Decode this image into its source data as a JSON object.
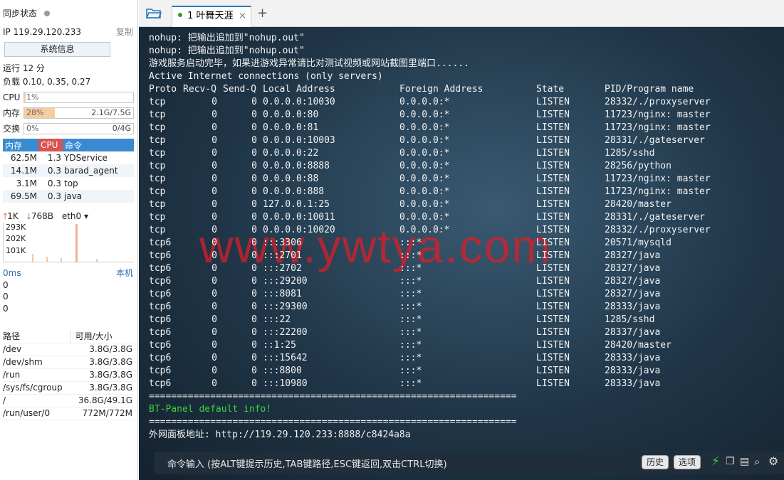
{
  "sidebar": {
    "sync_label": "同步状态",
    "ip": "IP 119.29.120.233",
    "copy": "复制",
    "sysinfo": "系统信息",
    "uptime": "运行 12 分",
    "load": "负载 0.10, 0.35, 0.27",
    "cpu_label": "CPU",
    "cpu_pct": "1%",
    "cpu_fill": 0.01,
    "mem_label": "内存",
    "mem_pct": "28%",
    "mem_size": "2.1G/7.5G",
    "mem_fill": 0.28,
    "swap_label": "交换",
    "swap_pct": "0%",
    "swap_size": "0/4G",
    "swap_fill": 0,
    "proc_headers": [
      "内存",
      "CPU",
      "命令"
    ],
    "procs": [
      [
        "62.5M",
        "1.3",
        "YDService"
      ],
      [
        "14.1M",
        "0.3",
        "barad_agent"
      ],
      [
        "3.1M",
        "0.3",
        "top"
      ],
      [
        "69.5M",
        "0.3",
        "java"
      ]
    ],
    "net_up": "1K",
    "net_down": "768B",
    "net_if": "eth0",
    "net_ticks": [
      "293K",
      "202K",
      "101K"
    ],
    "ping_label": "0ms",
    "ping_host": "本机",
    "ping_rows": [
      "0",
      "0",
      "0"
    ],
    "disk_headers": [
      "路径",
      "可用/大小"
    ],
    "disks": [
      [
        "/dev",
        "3.8G/3.8G"
      ],
      [
        "/dev/shm",
        "3.8G/3.8G"
      ],
      [
        "/run",
        "3.8G/3.8G"
      ],
      [
        "/sys/fs/cgroup",
        "3.8G/3.8G"
      ],
      [
        "/",
        "36.8G/49.1G"
      ],
      [
        "/run/user/0",
        "772M/772M"
      ]
    ]
  },
  "tabs": [
    {
      "label": "1 叶舞天涯",
      "active": true
    }
  ],
  "terminal": {
    "intro": [
      "nohup: 把输出追加到\"nohup.out\"",
      "nohup: 把输出追加到\"nohup.out\"",
      "游戏服务启动完毕，如果进游戏异常请比对测试视频或网站截图里端口......",
      "Active Internet connections (only servers)"
    ],
    "headers": [
      "Proto",
      "Recv-Q",
      "Send-Q",
      "Local Address",
      "Foreign Address",
      "State",
      "PID/Program name"
    ],
    "rows": [
      [
        "tcp",
        "0",
        "0",
        "0.0.0.0:10030",
        "0.0.0.0:*",
        "LISTEN",
        "28332/./proxyserver"
      ],
      [
        "tcp",
        "0",
        "0",
        "0.0.0.0:80",
        "0.0.0.0:*",
        "LISTEN",
        "11723/nginx: master"
      ],
      [
        "tcp",
        "0",
        "0",
        "0.0.0.0:81",
        "0.0.0.0:*",
        "LISTEN",
        "11723/nginx: master"
      ],
      [
        "tcp",
        "0",
        "0",
        "0.0.0.0:10003",
        "0.0.0.0:*",
        "LISTEN",
        "28331/./gateserver"
      ],
      [
        "tcp",
        "0",
        "0",
        "0.0.0.0:22",
        "0.0.0.0:*",
        "LISTEN",
        "1285/sshd"
      ],
      [
        "tcp",
        "0",
        "0",
        "0.0.0.0:8888",
        "0.0.0.0:*",
        "LISTEN",
        "28256/python"
      ],
      [
        "tcp",
        "0",
        "0",
        "0.0.0.0:88",
        "0.0.0.0:*",
        "LISTEN",
        "11723/nginx: master"
      ],
      [
        "tcp",
        "0",
        "0",
        "0.0.0.0:888",
        "0.0.0.0:*",
        "LISTEN",
        "11723/nginx: master"
      ],
      [
        "tcp",
        "0",
        "0",
        "127.0.0.1:25",
        "0.0.0.0:*",
        "LISTEN",
        "28420/master"
      ],
      [
        "tcp",
        "0",
        "0",
        "0.0.0.0:10011",
        "0.0.0.0:*",
        "LISTEN",
        "28331/./gateserver"
      ],
      [
        "tcp",
        "0",
        "0",
        "0.0.0.0:10020",
        "0.0.0.0:*",
        "LISTEN",
        "28332/./proxyserver"
      ],
      [
        "tcp6",
        "0",
        "0",
        ":::3306",
        ":::*",
        "LISTEN",
        "20571/mysqld"
      ],
      [
        "tcp6",
        "0",
        "0",
        ":::2701",
        ":::*",
        "LISTEN",
        "28327/java"
      ],
      [
        "tcp6",
        "0",
        "0",
        ":::2702",
        ":::*",
        "LISTEN",
        "28327/java"
      ],
      [
        "tcp6",
        "0",
        "0",
        ":::29200",
        ":::*",
        "LISTEN",
        "28327/java"
      ],
      [
        "tcp6",
        "0",
        "0",
        ":::8081",
        ":::*",
        "LISTEN",
        "28327/java"
      ],
      [
        "tcp6",
        "0",
        "0",
        ":::29300",
        ":::*",
        "LISTEN",
        "28333/java"
      ],
      [
        "tcp6",
        "0",
        "0",
        ":::22",
        ":::*",
        "LISTEN",
        "1285/sshd"
      ],
      [
        "tcp6",
        "0",
        "0",
        ":::22200",
        ":::*",
        "LISTEN",
        "28337/java"
      ],
      [
        "tcp6",
        "0",
        "0",
        "::1:25",
        ":::*",
        "LISTEN",
        "28420/master"
      ],
      [
        "tcp6",
        "0",
        "0",
        ":::15642",
        ":::*",
        "LISTEN",
        "28333/java"
      ],
      [
        "tcp6",
        "0",
        "0",
        ":::8800",
        ":::*",
        "LISTEN",
        "28333/java"
      ],
      [
        "tcp6",
        "0",
        "0",
        ":::10980",
        ":::*",
        "LISTEN",
        "28333/java"
      ]
    ],
    "sep": "==================================================================",
    "bt_info": "BT-Panel default info!",
    "panel_addr": "外网面板地址: http://119.29.120.233:8888/c8424a8a",
    "watermark": "www.ywtya.com"
  },
  "cmdbar": {
    "placeholder": "命令输入 (按ALT键提示历史,TAB键路径,ESC键返回,双击CTRL切换)",
    "history": "历史",
    "options": "选项"
  }
}
